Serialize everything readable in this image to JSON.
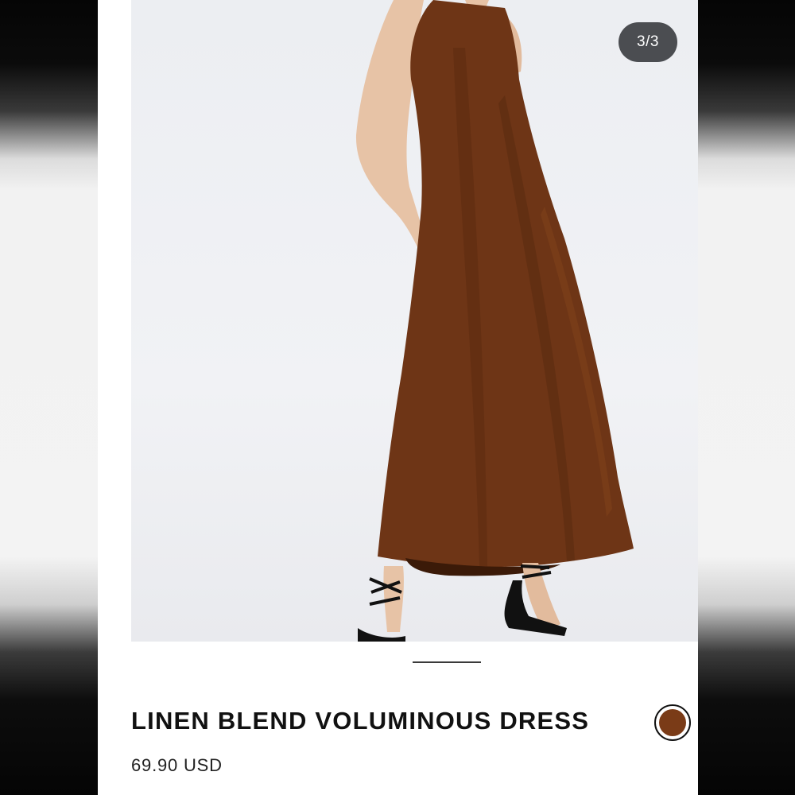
{
  "gallery": {
    "counter": "3/3",
    "image_icon": "product-photo-brown-dress"
  },
  "product": {
    "title": "LINEN BLEND VOLUMINOUS DRESS",
    "price": "69.90 USD",
    "color_swatch": "#7a3b17"
  },
  "colors": {
    "dress": "#6e3516",
    "dress_shadow": "#4f240d",
    "skin": "#e7c3a6",
    "background": "#eef0f3",
    "badge": "#4b4d51"
  }
}
